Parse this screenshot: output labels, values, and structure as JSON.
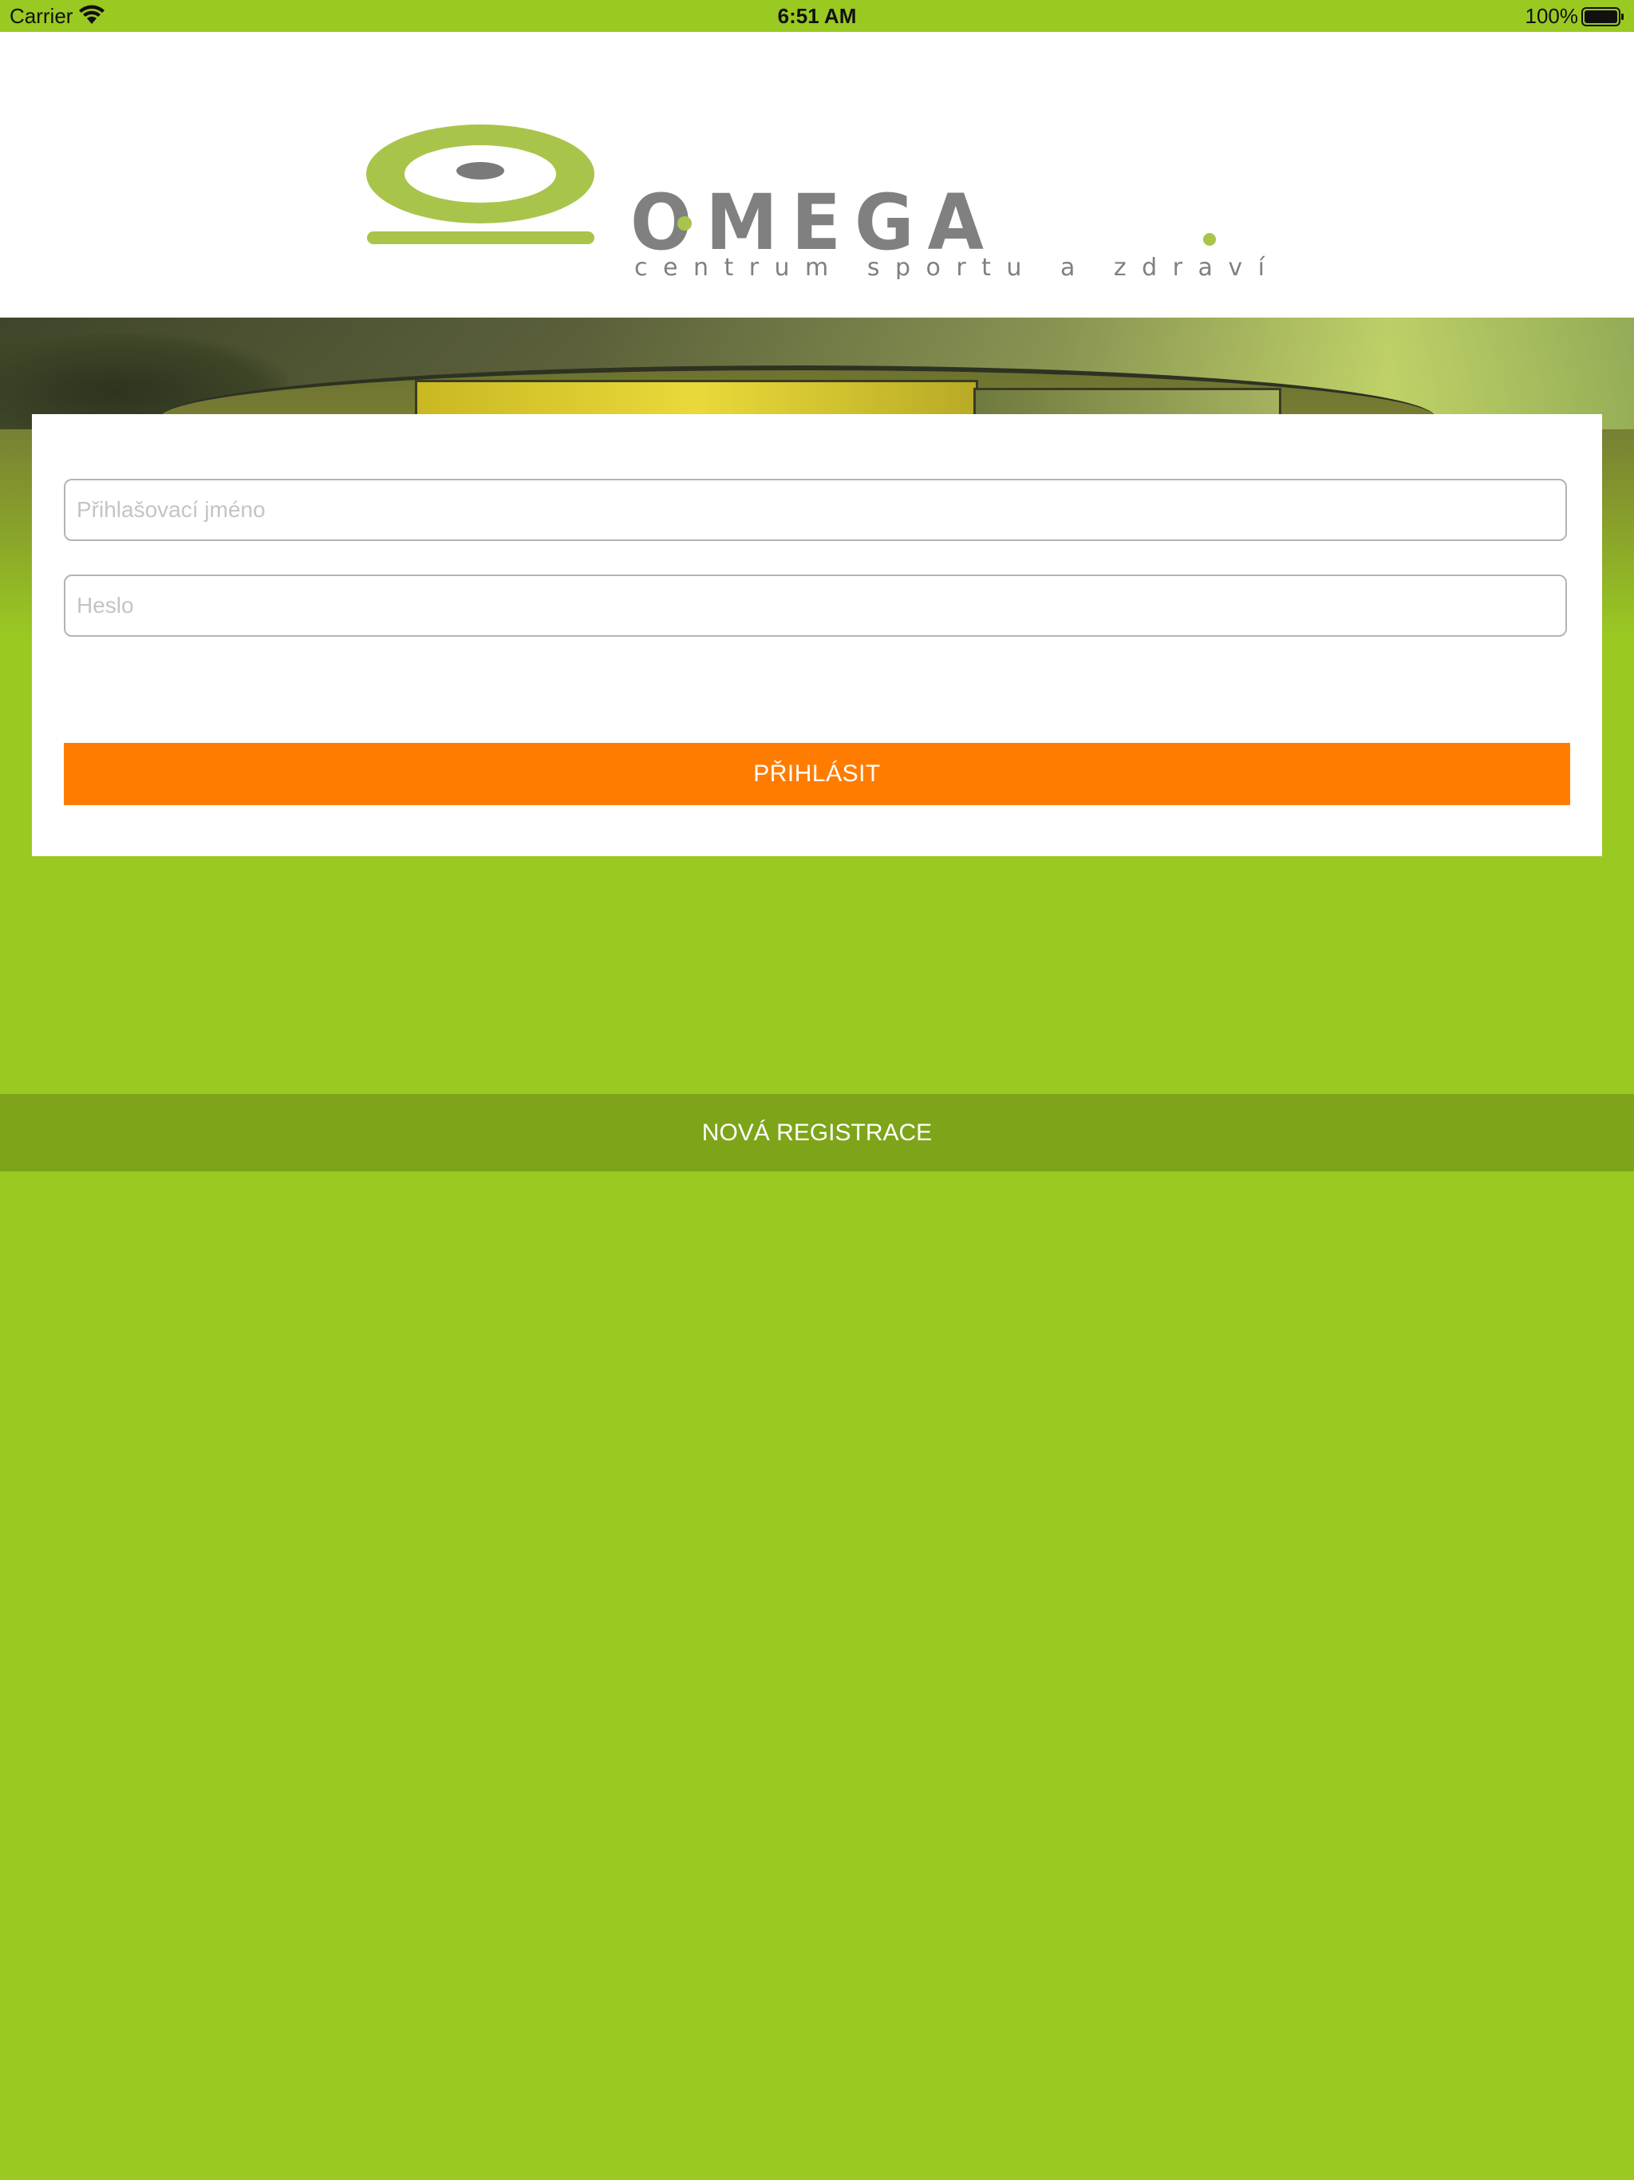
{
  "status_bar": {
    "carrier": "Carrier",
    "time": "6:51 AM",
    "battery_percent": "100%"
  },
  "logo": {
    "brand": "OMEGA",
    "tagline": "centrum sportu a zdraví",
    "logo_green": "#a9c44a",
    "logo_gray": "#808080"
  },
  "login_form": {
    "username_placeholder": "Přihlašovací jméno",
    "password_placeholder": "Heslo",
    "submit_label": "PŘIHLÁSIT"
  },
  "register": {
    "label": "NOVÁ REGISTRACE"
  },
  "colors": {
    "background": "#9ac922",
    "accent": "#ff7c00",
    "register_bar": "#7ea41a"
  }
}
